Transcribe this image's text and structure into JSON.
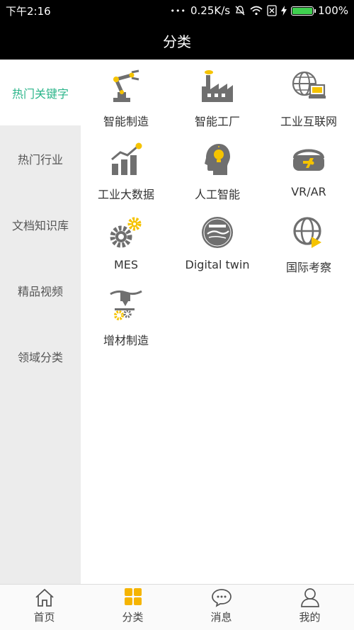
{
  "status_bar": {
    "time": "下午2:16",
    "dots": "•••",
    "speed": "0.25K/s",
    "battery_percent": "100%",
    "battery_level": 1.0
  },
  "header": {
    "title": "分类"
  },
  "sidebar": {
    "items": [
      {
        "label": "热门关键字",
        "active": true
      },
      {
        "label": "热门行业",
        "active": false
      },
      {
        "label": "文档知识库",
        "active": false
      },
      {
        "label": "精品视频",
        "active": false
      },
      {
        "label": "领域分类",
        "active": false
      }
    ]
  },
  "grid": {
    "items": [
      {
        "label": "智能制造",
        "icon": "robot-arm-icon"
      },
      {
        "label": "智能工厂",
        "icon": "factory-icon"
      },
      {
        "label": "工业互联网",
        "icon": "globe-computer-icon"
      },
      {
        "label": "工业大数据",
        "icon": "bar-chart-icon"
      },
      {
        "label": "人工智能",
        "icon": "ai-head-icon"
      },
      {
        "label": "VR/AR",
        "icon": "vr-headset-icon"
      },
      {
        "label": "MES",
        "icon": "gears-icon"
      },
      {
        "label": "Digital twin",
        "icon": "digital-twin-icon"
      },
      {
        "label": "国际考察",
        "icon": "globe-play-icon"
      },
      {
        "label": "增材制造",
        "icon": "3d-printer-icon"
      }
    ]
  },
  "bottom_nav": {
    "items": [
      {
        "label": "首页",
        "icon": "home-icon"
      },
      {
        "label": "分类",
        "icon": "category-grid-icon",
        "active": true
      },
      {
        "label": "消息",
        "icon": "message-icon"
      },
      {
        "label": "我的",
        "icon": "profile-icon"
      }
    ]
  },
  "colors": {
    "accent": "#2bb58a",
    "icon_gray": "#6f6f6f",
    "icon_yellow": "#f5c300",
    "nav_active": "#f5b400"
  }
}
